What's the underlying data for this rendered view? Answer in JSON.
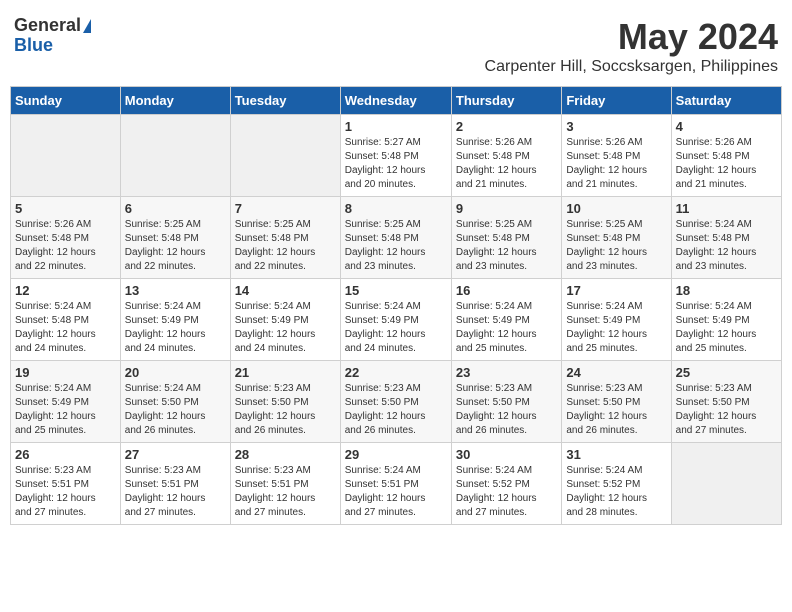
{
  "logo": {
    "general": "General",
    "blue": "Blue"
  },
  "title": "May 2024",
  "location": "Carpenter Hill, Soccsksargen, Philippines",
  "days_of_week": [
    "Sunday",
    "Monday",
    "Tuesday",
    "Wednesday",
    "Thursday",
    "Friday",
    "Saturday"
  ],
  "weeks": [
    [
      {
        "day": "",
        "info": ""
      },
      {
        "day": "",
        "info": ""
      },
      {
        "day": "",
        "info": ""
      },
      {
        "day": "1",
        "info": "Sunrise: 5:27 AM\nSunset: 5:48 PM\nDaylight: 12 hours\nand 20 minutes."
      },
      {
        "day": "2",
        "info": "Sunrise: 5:26 AM\nSunset: 5:48 PM\nDaylight: 12 hours\nand 21 minutes."
      },
      {
        "day": "3",
        "info": "Sunrise: 5:26 AM\nSunset: 5:48 PM\nDaylight: 12 hours\nand 21 minutes."
      },
      {
        "day": "4",
        "info": "Sunrise: 5:26 AM\nSunset: 5:48 PM\nDaylight: 12 hours\nand 21 minutes."
      }
    ],
    [
      {
        "day": "5",
        "info": "Sunrise: 5:26 AM\nSunset: 5:48 PM\nDaylight: 12 hours\nand 22 minutes."
      },
      {
        "day": "6",
        "info": "Sunrise: 5:25 AM\nSunset: 5:48 PM\nDaylight: 12 hours\nand 22 minutes."
      },
      {
        "day": "7",
        "info": "Sunrise: 5:25 AM\nSunset: 5:48 PM\nDaylight: 12 hours\nand 22 minutes."
      },
      {
        "day": "8",
        "info": "Sunrise: 5:25 AM\nSunset: 5:48 PM\nDaylight: 12 hours\nand 23 minutes."
      },
      {
        "day": "9",
        "info": "Sunrise: 5:25 AM\nSunset: 5:48 PM\nDaylight: 12 hours\nand 23 minutes."
      },
      {
        "day": "10",
        "info": "Sunrise: 5:25 AM\nSunset: 5:48 PM\nDaylight: 12 hours\nand 23 minutes."
      },
      {
        "day": "11",
        "info": "Sunrise: 5:24 AM\nSunset: 5:48 PM\nDaylight: 12 hours\nand 23 minutes."
      }
    ],
    [
      {
        "day": "12",
        "info": "Sunrise: 5:24 AM\nSunset: 5:48 PM\nDaylight: 12 hours\nand 24 minutes."
      },
      {
        "day": "13",
        "info": "Sunrise: 5:24 AM\nSunset: 5:49 PM\nDaylight: 12 hours\nand 24 minutes."
      },
      {
        "day": "14",
        "info": "Sunrise: 5:24 AM\nSunset: 5:49 PM\nDaylight: 12 hours\nand 24 minutes."
      },
      {
        "day": "15",
        "info": "Sunrise: 5:24 AM\nSunset: 5:49 PM\nDaylight: 12 hours\nand 24 minutes."
      },
      {
        "day": "16",
        "info": "Sunrise: 5:24 AM\nSunset: 5:49 PM\nDaylight: 12 hours\nand 25 minutes."
      },
      {
        "day": "17",
        "info": "Sunrise: 5:24 AM\nSunset: 5:49 PM\nDaylight: 12 hours\nand 25 minutes."
      },
      {
        "day": "18",
        "info": "Sunrise: 5:24 AM\nSunset: 5:49 PM\nDaylight: 12 hours\nand 25 minutes."
      }
    ],
    [
      {
        "day": "19",
        "info": "Sunrise: 5:24 AM\nSunset: 5:49 PM\nDaylight: 12 hours\nand 25 minutes."
      },
      {
        "day": "20",
        "info": "Sunrise: 5:24 AM\nSunset: 5:50 PM\nDaylight: 12 hours\nand 26 minutes."
      },
      {
        "day": "21",
        "info": "Sunrise: 5:23 AM\nSunset: 5:50 PM\nDaylight: 12 hours\nand 26 minutes."
      },
      {
        "day": "22",
        "info": "Sunrise: 5:23 AM\nSunset: 5:50 PM\nDaylight: 12 hours\nand 26 minutes."
      },
      {
        "day": "23",
        "info": "Sunrise: 5:23 AM\nSunset: 5:50 PM\nDaylight: 12 hours\nand 26 minutes."
      },
      {
        "day": "24",
        "info": "Sunrise: 5:23 AM\nSunset: 5:50 PM\nDaylight: 12 hours\nand 26 minutes."
      },
      {
        "day": "25",
        "info": "Sunrise: 5:23 AM\nSunset: 5:50 PM\nDaylight: 12 hours\nand 27 minutes."
      }
    ],
    [
      {
        "day": "26",
        "info": "Sunrise: 5:23 AM\nSunset: 5:51 PM\nDaylight: 12 hours\nand 27 minutes."
      },
      {
        "day": "27",
        "info": "Sunrise: 5:23 AM\nSunset: 5:51 PM\nDaylight: 12 hours\nand 27 minutes."
      },
      {
        "day": "28",
        "info": "Sunrise: 5:23 AM\nSunset: 5:51 PM\nDaylight: 12 hours\nand 27 minutes."
      },
      {
        "day": "29",
        "info": "Sunrise: 5:24 AM\nSunset: 5:51 PM\nDaylight: 12 hours\nand 27 minutes."
      },
      {
        "day": "30",
        "info": "Sunrise: 5:24 AM\nSunset: 5:52 PM\nDaylight: 12 hours\nand 27 minutes."
      },
      {
        "day": "31",
        "info": "Sunrise: 5:24 AM\nSunset: 5:52 PM\nDaylight: 12 hours\nand 28 minutes."
      },
      {
        "day": "",
        "info": ""
      }
    ]
  ]
}
